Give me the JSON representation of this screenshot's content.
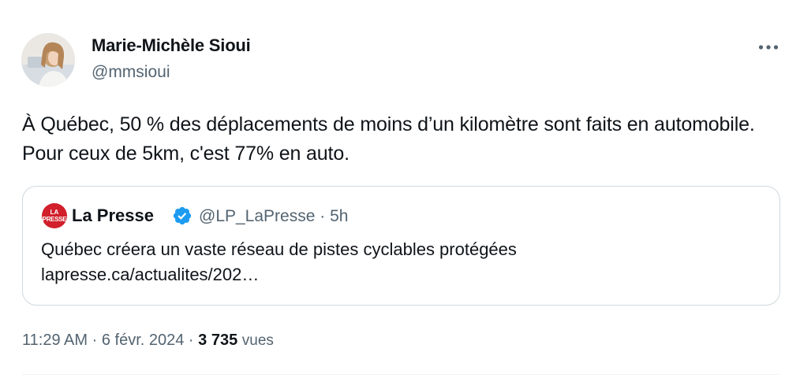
{
  "author": {
    "name": "Marie-Michèle Sioui",
    "handle": "@mmsioui"
  },
  "tweet": {
    "text": "À Québec, 50 % des déplacements de moins d’un kilomètre sont faits en automobile. Pour ceux de 5km, c'est 77% en auto."
  },
  "quote": {
    "avatar_text_line1": "LA",
    "avatar_text_line2": "PRESSE",
    "author_name": "La Presse",
    "handle": "@LP_LaPresse",
    "separator": "·",
    "age": "5h",
    "text": "Québec créera un vaste réseau de pistes cyclables protégées",
    "link": "lapresse.ca/actualites/202…",
    "verified_color": "#1d9bf0",
    "brand_color": "#d11f2b"
  },
  "meta": {
    "time": "11:29 AM",
    "separator1": "·",
    "date": "6 févr. 2024",
    "separator2": "·",
    "views_count": "3 735",
    "views_label": "vues"
  },
  "icons": {
    "more": "more-horizontal-icon",
    "verified": "verified-badge-icon"
  }
}
